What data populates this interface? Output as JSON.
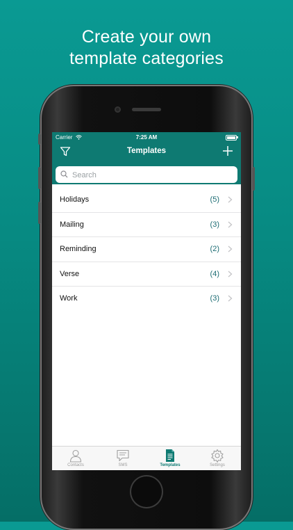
{
  "headline": {
    "line1": "Create your own",
    "line2": "template categories"
  },
  "status_bar": {
    "carrier": "Carrier",
    "time": "7:25 AM"
  },
  "nav": {
    "title": "Templates",
    "left_icon": "filter-icon",
    "right_icon": "plus-icon"
  },
  "search": {
    "placeholder": "Search",
    "value": ""
  },
  "categories": [
    {
      "name": "Holidays",
      "count": "(5)"
    },
    {
      "name": "Mailing",
      "count": "(3)"
    },
    {
      "name": "Reminding",
      "count": "(2)"
    },
    {
      "name": "Verse",
      "count": "(4)"
    },
    {
      "name": "Work",
      "count": "(3)"
    }
  ],
  "tabs": [
    {
      "label": "Contacts",
      "icon": "person-icon",
      "active": false
    },
    {
      "label": "SMS",
      "icon": "speech-bubble-icon",
      "active": false
    },
    {
      "label": "Templates",
      "icon": "document-icon",
      "active": true
    },
    {
      "label": "Settings",
      "icon": "gear-icon",
      "active": false
    }
  ],
  "colors": {
    "accent": "#0e7a72",
    "background_top": "#0a9a93",
    "background_bottom": "#056e66",
    "count_text": "#1b6b72"
  }
}
